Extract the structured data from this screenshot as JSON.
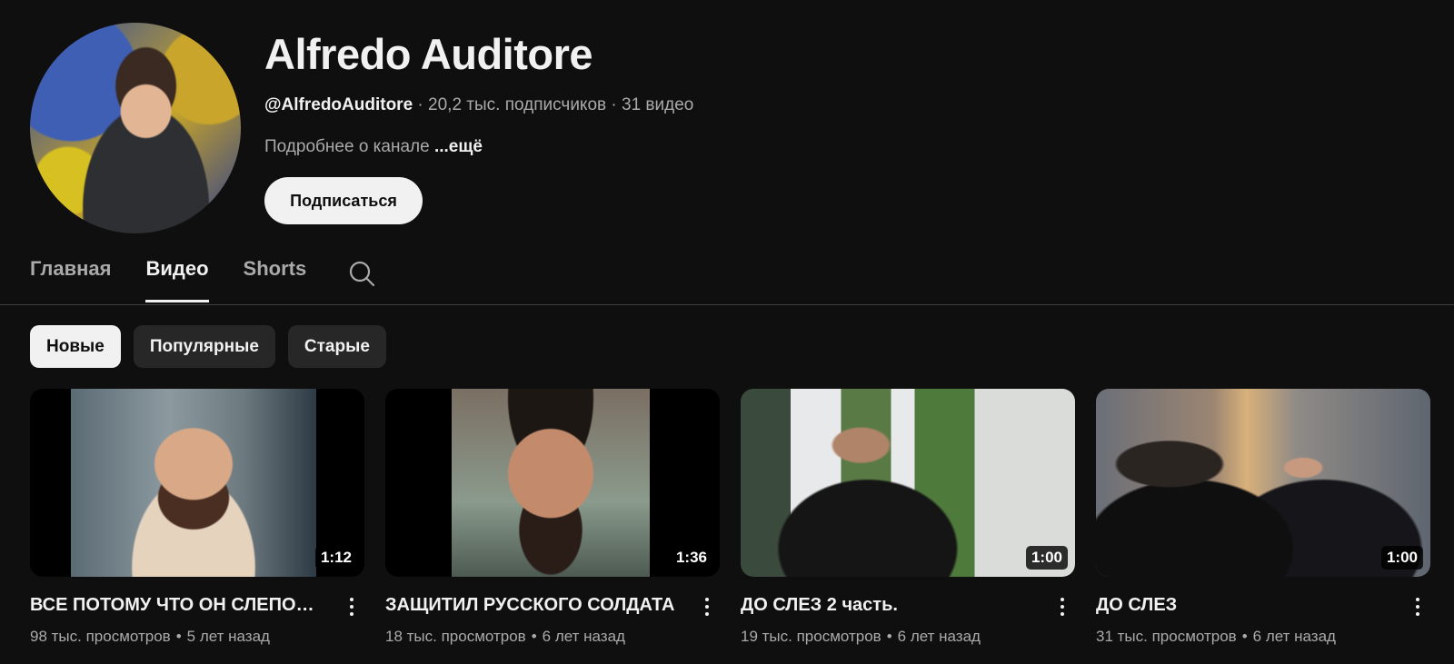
{
  "channel": {
    "name": "Alfredo Auditore",
    "handle": "@AlfredoAuditore",
    "subscribers": "20,2 тыс. подписчиков",
    "video_count": "31 видео",
    "separator": "·",
    "description": "Подробнее о канале",
    "more": "...ещё",
    "subscribe_label": "Подписаться"
  },
  "tabs": [
    {
      "label": "Главная",
      "active": false
    },
    {
      "label": "Видео",
      "active": true
    },
    {
      "label": "Shorts",
      "active": false
    }
  ],
  "filters": [
    {
      "label": "Новые",
      "selected": true
    },
    {
      "label": "Популярные",
      "selected": false
    },
    {
      "label": "Старые",
      "selected": false
    }
  ],
  "videos": [
    {
      "title": "ВСЕ ПОТОМУ ЧТО ОН СЛЕПОЙ...",
      "duration": "1:12",
      "views": "98 тыс. просмотров",
      "age": "5 лет назад"
    },
    {
      "title": "ЗАЩИТИЛ РУССКОГО СОЛДАТА",
      "duration": "1:36",
      "views": "18 тыс. просмотров",
      "age": "6 лет назад"
    },
    {
      "title": "ДО СЛЕЗ 2 часть.",
      "duration": "1:00",
      "views": "19 тыс. просмотров",
      "age": "6 лет назад"
    },
    {
      "title": "ДО СЛЕЗ",
      "duration": "1:00",
      "views": "31 тыс. просмотров",
      "age": "6 лет назад"
    }
  ],
  "meta_dot": "•",
  "icons": {
    "tab_search": "search-icon",
    "video_menu": "more-vert-icon"
  }
}
